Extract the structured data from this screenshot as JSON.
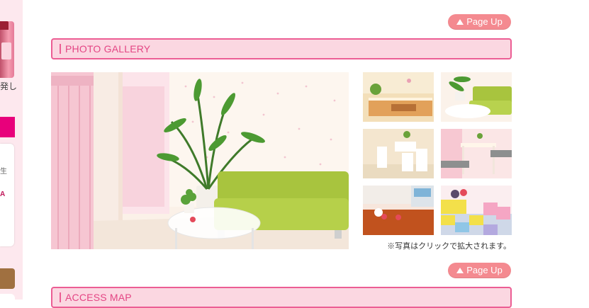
{
  "sidebar": {
    "text_fragment": "発し",
    "panel_text_1": "生",
    "panel_text_2": "A"
  },
  "page_up": {
    "label": "Page Up"
  },
  "gallery": {
    "title": "PHOTO GALLERY",
    "caption": "※写真はクリックで拡大されます。"
  },
  "access": {
    "title": "ACCESS MAP"
  },
  "colors": {
    "accent_pink": "#ec5e94",
    "header_bg": "#fbd7e1",
    "button_salmon": "#f48a90",
    "sidebar_magenta": "#e8007b"
  }
}
